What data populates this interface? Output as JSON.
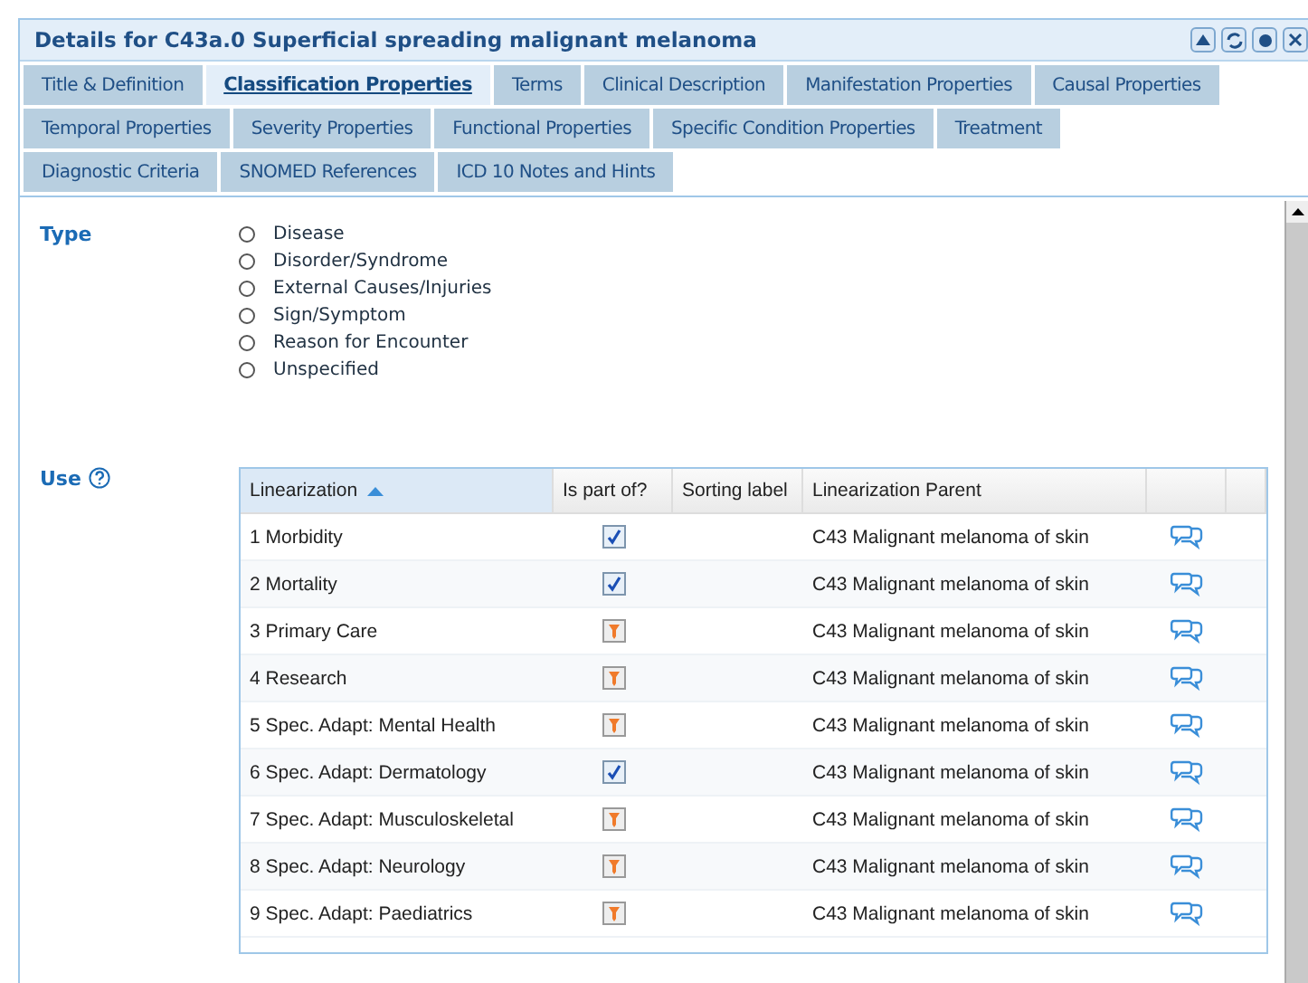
{
  "window": {
    "title": "Details for C43a.0 Superficial spreading malignant melanoma"
  },
  "tabs": [
    [
      {
        "label": "Title & Definition",
        "selected": false
      },
      {
        "label": "Classification Properties",
        "selected": true
      },
      {
        "label": "Terms",
        "selected": false
      },
      {
        "label": "Clinical Description",
        "selected": false
      },
      {
        "label": "Manifestation Properties",
        "selected": false
      },
      {
        "label": "Causal Properties",
        "selected": false
      }
    ],
    [
      {
        "label": "Temporal Properties",
        "selected": false
      },
      {
        "label": "Severity Properties",
        "selected": false
      },
      {
        "label": "Functional Properties",
        "selected": false
      },
      {
        "label": "Specific Condition Properties",
        "selected": false
      },
      {
        "label": "Treatment",
        "selected": false
      }
    ],
    [
      {
        "label": "Diagnostic Criteria",
        "selected": false
      },
      {
        "label": "SNOMED References",
        "selected": false
      },
      {
        "label": "ICD 10 Notes and Hints",
        "selected": false
      }
    ]
  ],
  "type": {
    "label": "Type",
    "options": [
      {
        "label": "Disease",
        "selected": false
      },
      {
        "label": "Disorder/Syndrome",
        "selected": false
      },
      {
        "label": "External Causes/Injuries",
        "selected": false
      },
      {
        "label": "Sign/Symptom",
        "selected": false
      },
      {
        "label": "Reason for Encounter",
        "selected": false
      },
      {
        "label": "Unspecified",
        "selected": false
      }
    ]
  },
  "use": {
    "label": "Use",
    "table": {
      "columns": [
        "Linearization",
        "Is part of?",
        "Sorting label",
        "Linearization Parent"
      ],
      "rows": [
        {
          "linearization": "1 Morbidity",
          "checked": true,
          "parent": "C43 Malignant melanoma of skin"
        },
        {
          "linearization": "2 Mortality",
          "checked": true,
          "parent": "C43 Malignant melanoma of skin"
        },
        {
          "linearization": "3 Primary Care",
          "checked": false,
          "parent": "C43 Malignant melanoma of skin"
        },
        {
          "linearization": "4 Research",
          "checked": false,
          "parent": "C43 Malignant melanoma of skin"
        },
        {
          "linearization": "5 Spec. Adapt: Mental Health",
          "checked": false,
          "parent": "C43 Malignant melanoma of skin"
        },
        {
          "linearization": "6 Spec. Adapt: Dermatology",
          "checked": true,
          "parent": "C43 Malignant melanoma of skin"
        },
        {
          "linearization": "7 Spec. Adapt: Musculoskeletal",
          "checked": false,
          "parent": "C43 Malignant melanoma of skin"
        },
        {
          "linearization": "8 Spec. Adapt: Neurology",
          "checked": false,
          "parent": "C43 Malignant melanoma of skin"
        },
        {
          "linearization": "9 Spec. Adapt: Paediatrics",
          "checked": false,
          "parent": "C43 Malignant melanoma of skin"
        }
      ]
    }
  }
}
